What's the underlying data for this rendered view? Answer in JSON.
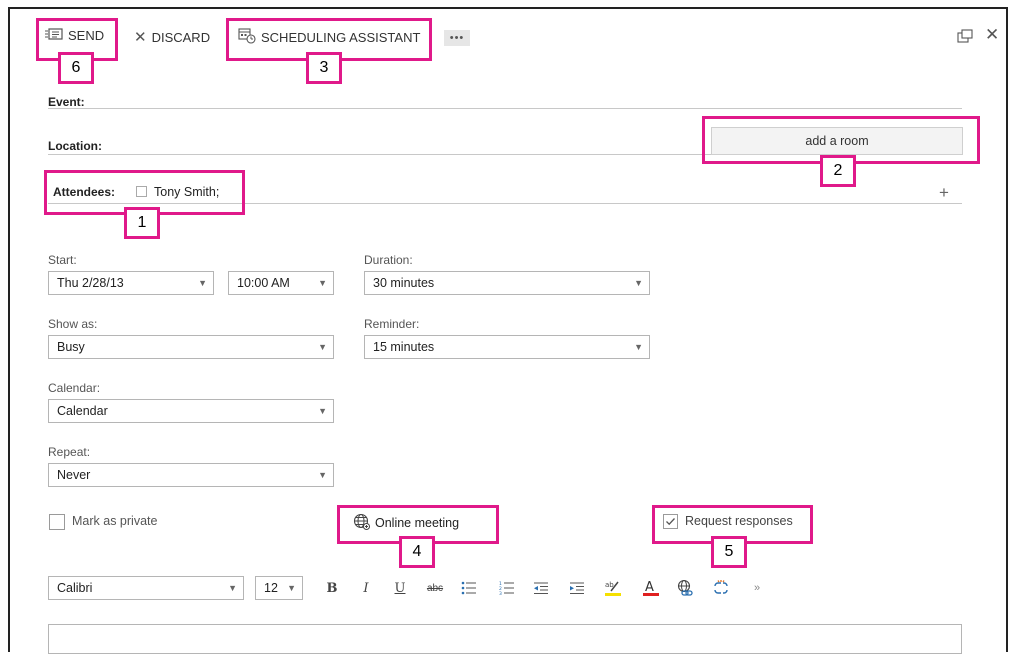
{
  "toolbar": {
    "send_label": "SEND",
    "discard_label": "DISCARD",
    "scheduling_label": "SCHEDULING ASSISTANT",
    "more_label": "•••"
  },
  "form": {
    "event_label": "Event:",
    "location_label": "Location:",
    "add_room_label": "add a room",
    "attendees_label": "Attendees:",
    "attendee_name": "Tony Smith;",
    "add_attendee_symbol": "+"
  },
  "fields": {
    "start_label": "Start:",
    "start_date": "Thu 2/28/13",
    "start_time": "10:00 AM",
    "duration_label": "Duration:",
    "duration_value": "30 minutes",
    "show_as_label": "Show as:",
    "show_as_value": "Busy",
    "reminder_label": "Reminder:",
    "reminder_value": "15 minutes",
    "calendar_label": "Calendar:",
    "calendar_value": "Calendar",
    "repeat_label": "Repeat:",
    "repeat_value": "Never"
  },
  "options": {
    "private_label": "Mark as private",
    "online_meeting_label": "Online meeting",
    "request_responses_label": "Request responses",
    "request_responses_checked": true
  },
  "format": {
    "font_name": "Calibri",
    "font_size": "12"
  },
  "callouts": {
    "c1": "1",
    "c2": "2",
    "c3": "3",
    "c4": "4",
    "c5": "5",
    "c6": "6"
  },
  "colors": {
    "highlight": "#e0198a"
  }
}
